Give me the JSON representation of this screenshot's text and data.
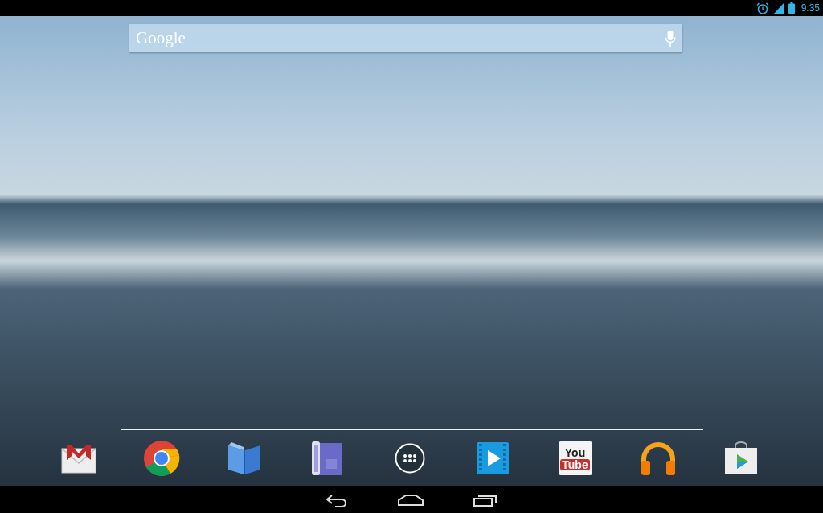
{
  "status_bar": {
    "time": "9:35",
    "alarm": true
  },
  "search_bar": {
    "logo": "Google"
  },
  "dock": [
    {
      "kind": "mail"
    },
    {
      "kind": "browser"
    },
    {
      "kind": "books"
    },
    {
      "kind": "notebook"
    },
    {
      "kind": "apps"
    },
    {
      "kind": "video"
    },
    {
      "kind": "youtube",
      "logo_text": [
        "You",
        "Tube"
      ]
    },
    {
      "kind": "music"
    },
    {
      "kind": "store"
    }
  ],
  "nav_bar": [
    {
      "kind": "back"
    },
    {
      "kind": "home"
    },
    {
      "kind": "recents"
    }
  ]
}
